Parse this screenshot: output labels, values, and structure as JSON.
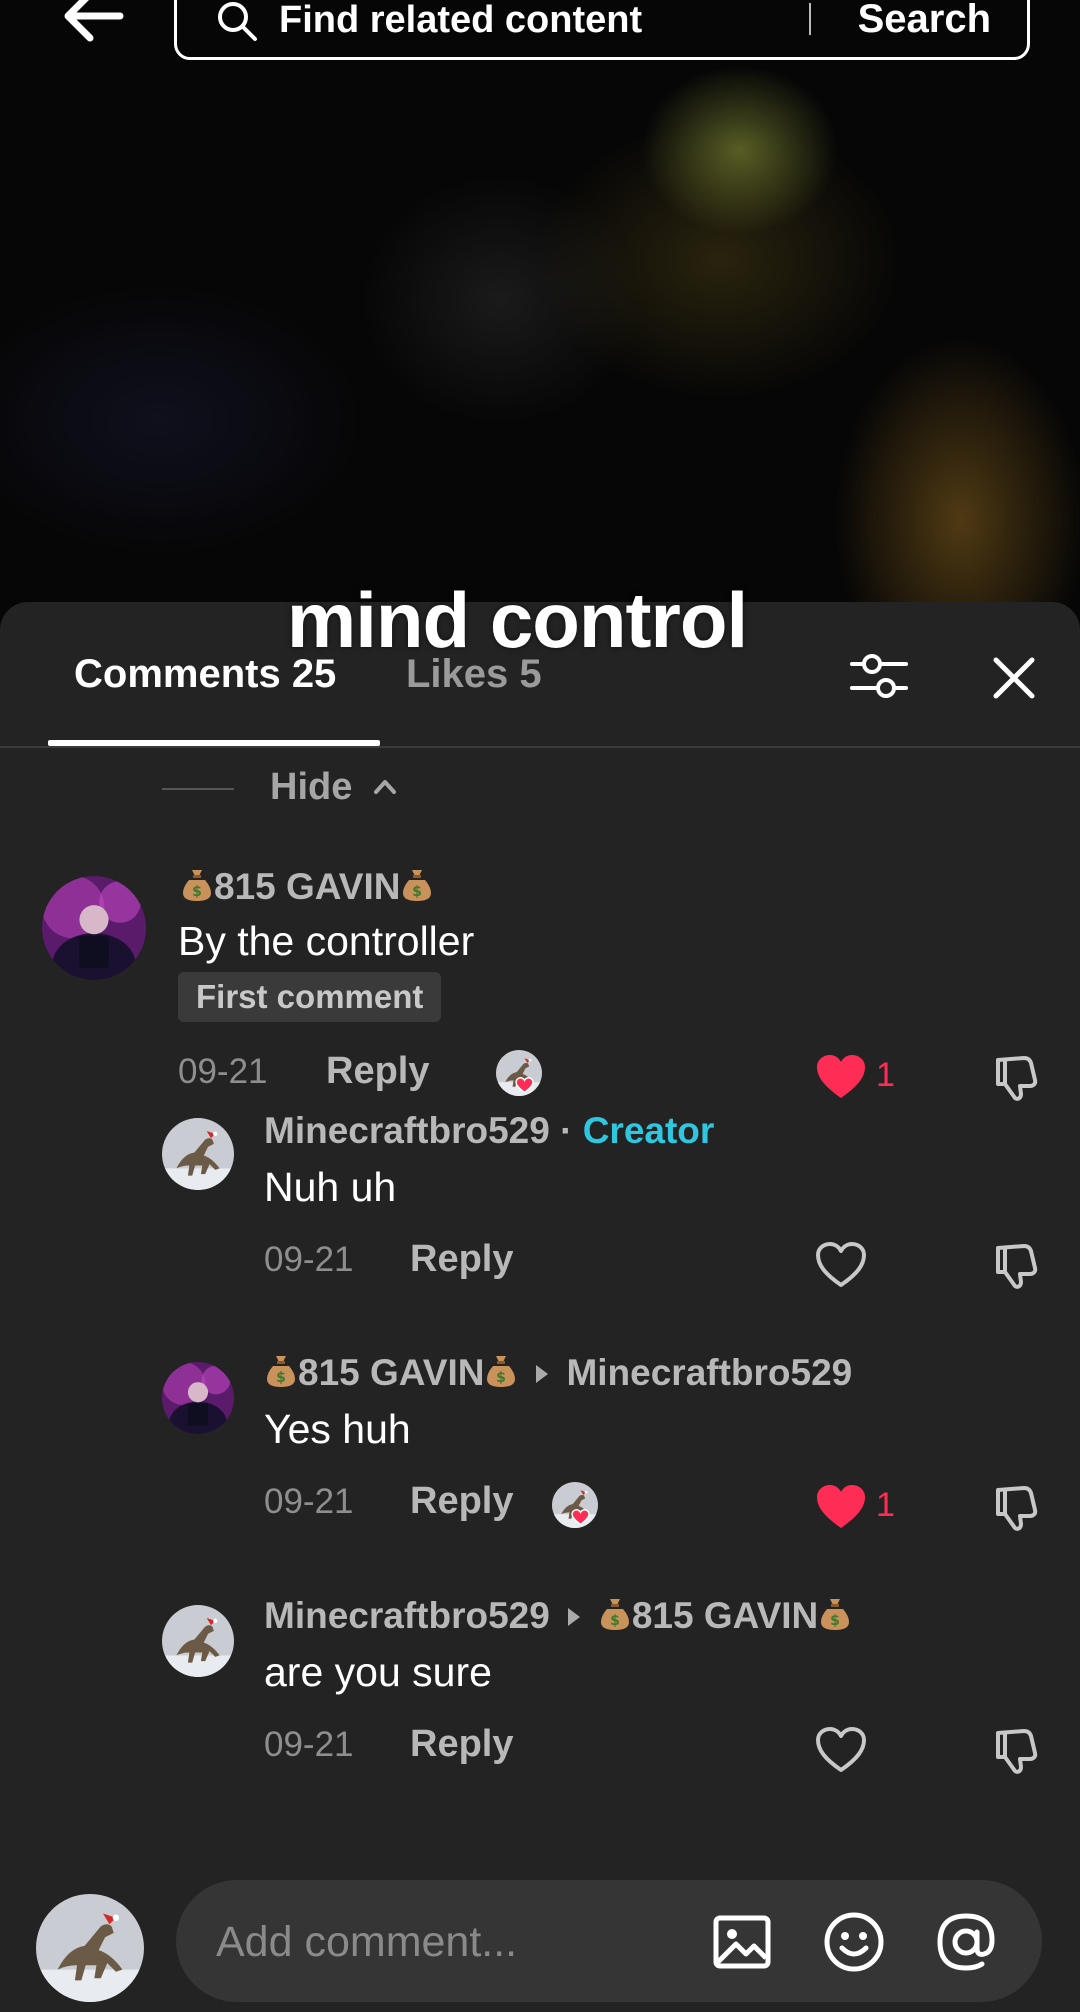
{
  "search": {
    "placeholder": "Find related content",
    "button_label": "Search"
  },
  "video": {
    "caption": "mind control"
  },
  "tabs": {
    "comments_label": "Comments 25",
    "likes_label": "Likes 5"
  },
  "hide_label": "Hide",
  "comments": [
    {
      "username": "815 GAVIN",
      "text": "By the controller",
      "badge": "First comment",
      "date": "09-21",
      "reply_label": "Reply",
      "liked": true,
      "like_count": "1"
    },
    {
      "username": "Minecraftbro529",
      "creator_tag": "Creator",
      "creator_sep": " · ",
      "text": "Nuh uh",
      "date": "09-21",
      "reply_label": "Reply",
      "liked": false
    },
    {
      "username": "815 GAVIN",
      "reply_to": "Minecraftbro529",
      "text": "Yes huh",
      "date": "09-21",
      "reply_label": "Reply",
      "liked": true,
      "like_count": "1"
    },
    {
      "username": "Minecraftbro529",
      "reply_to": "815 GAVIN",
      "text": "are you sure",
      "date": "09-21",
      "reply_label": "Reply",
      "liked": false
    }
  ],
  "composer": {
    "placeholder": "Add comment..."
  },
  "colors": {
    "sheet_bg": "#232323",
    "accent_like": "#ff2d55",
    "creator_tag": "#2fc7e0"
  }
}
